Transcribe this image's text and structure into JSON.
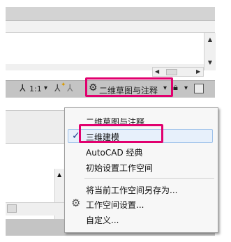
{
  "top": {
    "status": {
      "annotation_scale": "1:1",
      "annotation_scale_arrow": "▾",
      "workspace_label": "二维草图与注释",
      "workspace_arrow": "▾"
    }
  },
  "menu": {
    "items": [
      {
        "label": "二维草图与注释"
      },
      {
        "label": "三维建模",
        "checked": true
      },
      {
        "label": "AutoCAD 经典"
      },
      {
        "label": "初始设置工作空间"
      },
      {
        "label": "将当前工作空间另存为..."
      },
      {
        "label": "工作空间设置..."
      },
      {
        "label": "自定义..."
      }
    ]
  },
  "colors": {
    "highlight": "#e1006e",
    "statusbar": "#c4c4c4",
    "menu_bg": "#f7f7f7",
    "selected_bg": "#e7f0fb"
  },
  "icons": [
    "annotation-scale-icon",
    "annotation-visibility-icon",
    "auto-scale-icon",
    "workspace-gear-icon",
    "lock-icon",
    "fullscreen-icon",
    "check-icon",
    "settings-gear-icon"
  ]
}
